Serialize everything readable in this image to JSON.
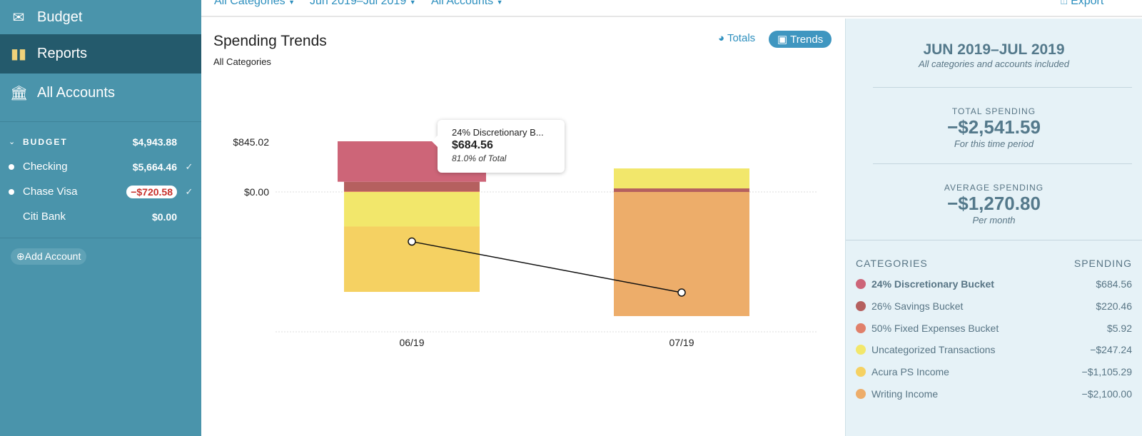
{
  "sidebar": {
    "nav": [
      {
        "label": "Budget",
        "icon": "envelope-icon"
      },
      {
        "label": "Reports",
        "icon": "bar-chart-icon"
      },
      {
        "label": "All Accounts",
        "icon": "bank-icon"
      }
    ],
    "group": {
      "label": "BUDGET",
      "amount": "$4,943.88"
    },
    "accounts": [
      {
        "name": "Checking",
        "amount": "$5,664.46",
        "negative": false
      },
      {
        "name": "Chase Visa",
        "amount": "−$720.58",
        "negative": true
      },
      {
        "name": "Citi Bank",
        "amount": "$0.00",
        "negative": false
      }
    ],
    "add_account": "Add Account"
  },
  "filters": {
    "categories": "All Categories",
    "dates": "Jun 2019–Jul 2019",
    "accounts": "All Accounts",
    "export": "Export"
  },
  "main": {
    "title": "Spending Trends",
    "subtitle": "All Categories",
    "totals_label": "Totals",
    "trends_label": "Trends"
  },
  "tooltip": {
    "name": "24% Discretionary B...",
    "value": "$684.56",
    "percent": "81.0% of Total"
  },
  "panel": {
    "range": "JUN 2019–JUL 2019",
    "range_note": "All categories and accounts included",
    "total_label": "TOTAL SPENDING",
    "total_value": "−$2,541.59",
    "total_note": "For this time period",
    "avg_label": "AVERAGE SPENDING",
    "avg_value": "−$1,270.80",
    "avg_note": "Per month",
    "cat_header": "CATEGORIES",
    "spend_header": "SPENDING",
    "categories": [
      {
        "name": "24% Discretionary Bucket",
        "amount": "$684.56",
        "color": "#cd6578"
      },
      {
        "name": "26% Savings Bucket",
        "amount": "$220.46",
        "color": "#b5605f"
      },
      {
        "name": "50% Fixed Expenses Bucket",
        "amount": "$5.92",
        "color": "#e0806a"
      },
      {
        "name": "Uncategorized Transactions",
        "amount": "−$247.24",
        "color": "#f2e76b"
      },
      {
        "name": "Acura PS Income",
        "amount": "−$1,105.29",
        "color": "#f5d162"
      },
      {
        "name": "Writing Income",
        "amount": "−$2,100.00",
        "color": "#edad6a"
      }
    ]
  },
  "chart_data": {
    "type": "bar",
    "stacked": true,
    "categories": [
      "06/19",
      "07/19"
    ],
    "y_tick_labels": [
      "$845.02",
      "$0.00"
    ],
    "highlighted": "24% Discretionary Bucket",
    "series": [
      {
        "name": "50% Fixed Expenses Bucket",
        "color": "#e0806a",
        "values": [
          5.92,
          0
        ]
      },
      {
        "name": "26% Savings Bucket",
        "color": "#b5605f",
        "values": [
          160.46,
          60
        ]
      },
      {
        "name": "24% Discretionary Bucket",
        "color": "#cd6578",
        "values": [
          684.56,
          0
        ]
      },
      {
        "name": "Uncategorized Transactions",
        "color": "#f2e76b",
        "values": [
          -585.24,
          338
        ]
      },
      {
        "name": "Acura PS Income",
        "color": "#f5d162",
        "values": [
          -1105.29,
          0
        ]
      },
      {
        "name": "Writing Income",
        "color": "#edad6a",
        "values": [
          0,
          -2100
        ]
      }
    ],
    "net_line": [
      -839.59,
      -1702
    ]
  }
}
